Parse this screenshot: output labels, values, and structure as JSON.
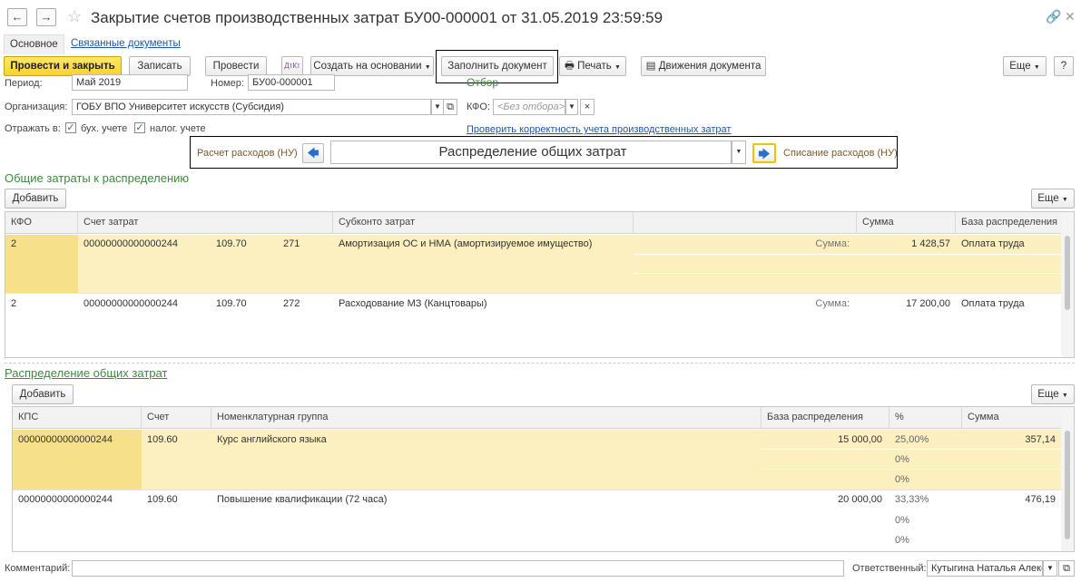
{
  "header": {
    "title": "Закрытие счетов производственных затрат БУ00-000001 от 31.05.2019 23:59:59",
    "back_glyph": "←",
    "forward_glyph": "→"
  },
  "tabs": {
    "main": "Основное",
    "related": "Связанные документы"
  },
  "toolbar": {
    "post_close": "Провести и закрыть",
    "save": "Записать",
    "post": "Провести",
    "create_based": "Создать на основании",
    "fill": "Заполнить документ",
    "print": "Печать",
    "movements": "Движения документа",
    "more": "Еще",
    "help": "?"
  },
  "fields": {
    "period_label": "Период:",
    "period_value": "Май 2019",
    "number_label": "Номер:",
    "number_value": "БУ00-000001",
    "org_label": "Организация:",
    "org_value": "ГОБУ ВПО Университет искусств (Субсидия)",
    "filter_title": "Отбор",
    "kfo_label": "КФО:",
    "kfo_placeholder": "<Без отбора>",
    "check_link": "Проверить корректность учета производственных затрат",
    "reflect_label": "Отражать в:",
    "acc_label": "бух. учете",
    "tax_label": "налог. учете"
  },
  "stepper": {
    "prev": "Расчет расходов (НУ)",
    "current": "Распределение общих затрат",
    "next": "Списание расходов (НУ)"
  },
  "section1": {
    "title": "Общие затраты к распределению",
    "add": "Добавить",
    "more": "Еще",
    "columns": [
      "КФО",
      "Счет затрат",
      "Субконто затрат",
      "",
      "Сумма",
      "База распределения"
    ],
    "rows": [
      {
        "kfo": "2",
        "account": "00000000000000244",
        "acct2": "109.70",
        "code": "271",
        "subconto": "Амортизация ОС и НМА (амортизируемое имущество)",
        "sum_label": "Сумма:",
        "sum": "1 428,57",
        "base": "Оплата труда"
      },
      {
        "kfo": "2",
        "account": "00000000000000244",
        "acct2": "109.70",
        "code": "272",
        "subconto": "Расходование МЗ (Канцтовары)",
        "sum_label": "Сумма:",
        "sum": "17 200,00",
        "base": "Оплата труда"
      }
    ]
  },
  "section2": {
    "title": "Распределение общих затрат",
    "add": "Добавить",
    "more": "Еще",
    "columns": [
      "КПС",
      "Счет",
      "Номенклатурная группа",
      "База распределения",
      "%",
      "Сумма"
    ],
    "rows": [
      {
        "kps": "00000000000000244",
        "account": "109.60",
        "group": "Курс английского языка",
        "base": "15 000,00",
        "pct": [
          "25,00%",
          "0%",
          "0%"
        ],
        "sum": "357,14"
      },
      {
        "kps": "00000000000000244",
        "account": "109.60",
        "group": "Повышение квалификации (72 часа)",
        "base": "20 000,00",
        "pct": [
          "33,33%",
          "0%",
          "0%"
        ],
        "sum": "476,19"
      }
    ]
  },
  "footer": {
    "comment_label": "Комментарий:",
    "comment_value": "",
    "responsible_label": "Ответственный:",
    "responsible_value": "Кутыгина Наталья Алекс"
  }
}
